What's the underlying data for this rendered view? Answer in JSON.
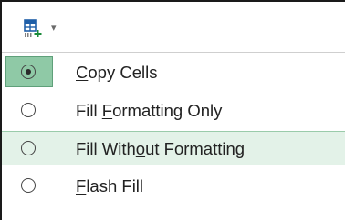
{
  "auto_fill_button": {
    "icon": "auto-fill-options-icon",
    "caret": "chevron-down-icon"
  },
  "menu": {
    "items": [
      {
        "pre": "",
        "accel": "C",
        "post": "opy Cells",
        "selected": true
      },
      {
        "pre": "Fill ",
        "accel": "F",
        "post": "ormatting Only",
        "selected": false
      },
      {
        "pre": "Fill With",
        "accel": "o",
        "post": "ut Formatting",
        "selected": false
      },
      {
        "pre": "",
        "accel": "F",
        "post": "lash Fill",
        "selected": false
      }
    ]
  },
  "colors": {
    "selected_radio_bg": "#8fc9a6",
    "hover_bg": "#e3f2e8",
    "hover_border": "#9acbaa"
  }
}
